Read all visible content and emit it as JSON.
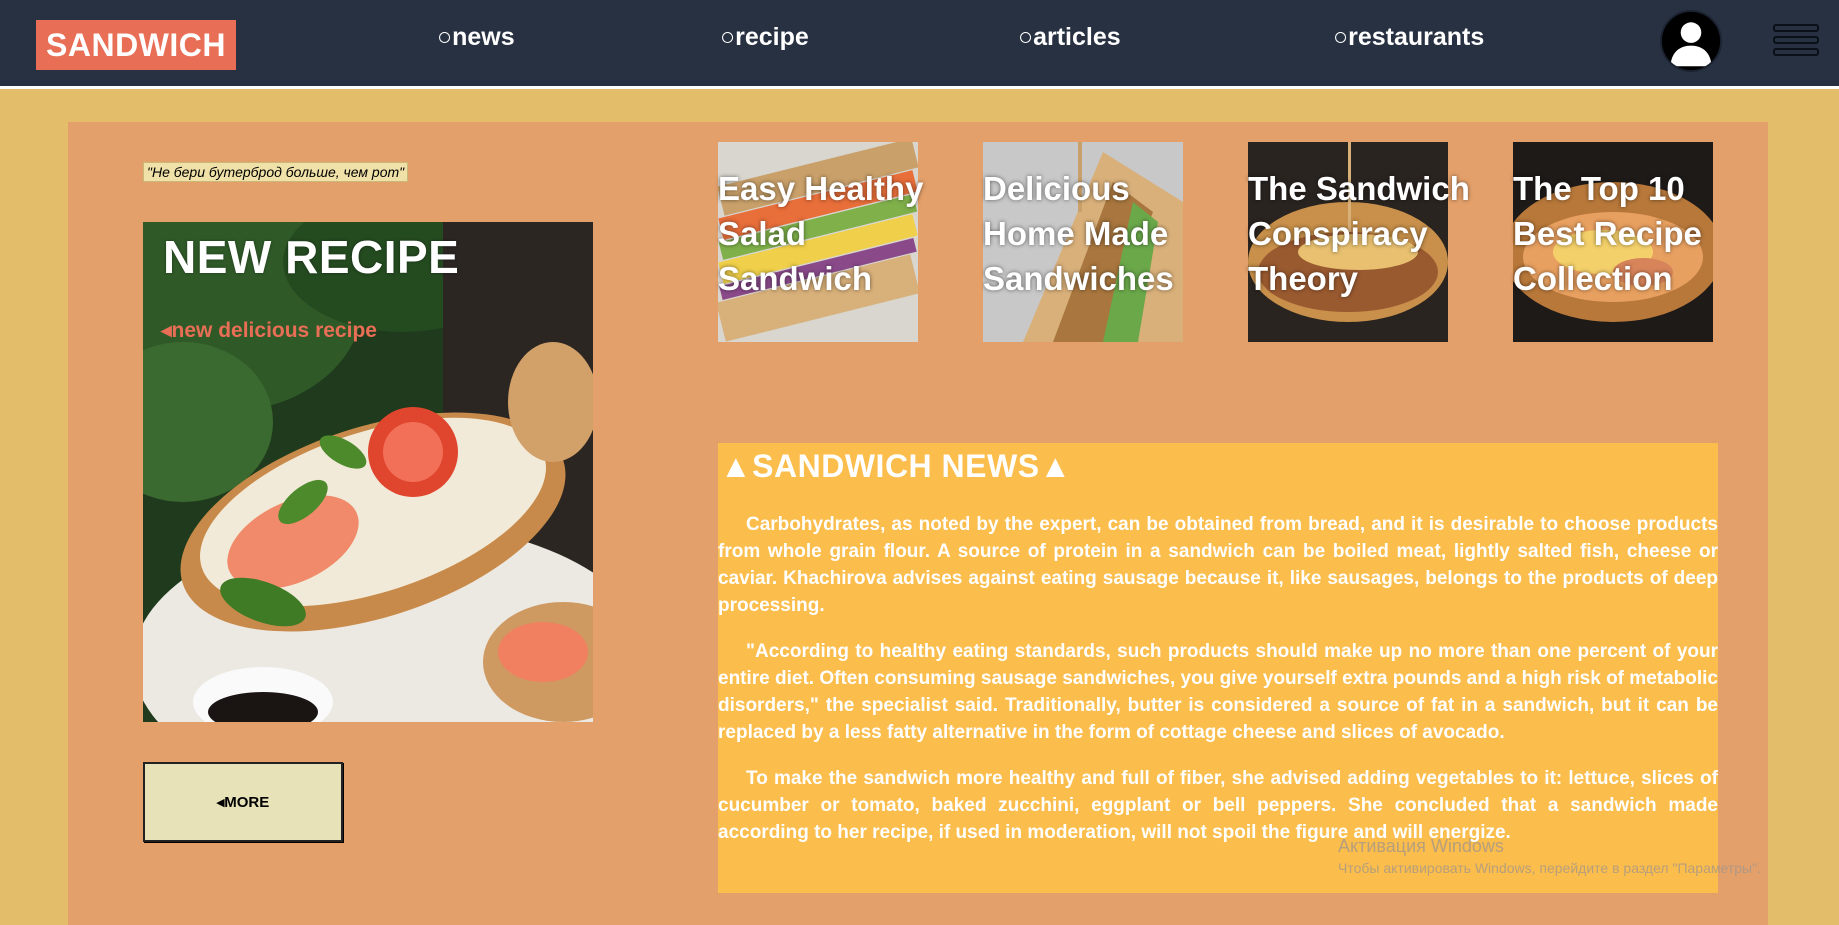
{
  "header": {
    "logo": "SANDWICH",
    "nav": [
      {
        "label": "○news"
      },
      {
        "label": "○recipe"
      },
      {
        "label": "○articles"
      },
      {
        "label": "○restaurants"
      }
    ],
    "avatar_icon": "user-avatar-icon",
    "menu_icon": "hamburger-menu-icon"
  },
  "main": {
    "quote": "\"Не бери бутерброд больше, чем рот\"",
    "hero": {
      "title": "NEW RECIPE",
      "subtitle": "◂new delicious recipe"
    },
    "more_button": "◂MORE",
    "cards": [
      {
        "label": "Easy Healthy Salad Sandwich"
      },
      {
        "label": "Delicious Home Made Sandwiches"
      },
      {
        "label": "The Sandwich Conspiracy Theory"
      },
      {
        "label": "The Top 10 Best Recipe Collection"
      }
    ],
    "news": {
      "title": "▲SANDWICH NEWS▲",
      "paragraphs": [
        "Carbohydrates, as noted by the expert, can be obtained from bread, and it is desirable to choose products from whole grain flour. A source of protein in a sandwich can be boiled meat, lightly salted fish, cheese or caviar. Khachirova advises against eating sausage because it, like sausages, belongs to the products of deep processing.",
        "\"According to healthy eating standards, such products should make up no more than one percent of your entire diet. Often consuming sausage sandwiches, you give yourself extra pounds and a high risk of metabolic disorders,\" the specialist said. Traditionally, butter is considered a source of fat in a sandwich, but it can be replaced by a less fatty alternative in the form of cottage cheese and slices of avocado.",
        "To make the sandwich more healthy and full of fiber, she advised adding vegetables to it: lettuce, slices of cucumber or tomato, baked zucchini, eggplant or bell peppers. She concluded that a sandwich made according to her recipe, if used in moderation, will not spoil the figure and will energize."
      ]
    }
  },
  "watermark": {
    "line1": "Активация Windows",
    "line2": "Чтобы активировать Windows, перейдите в раздел \"Параметры\"."
  },
  "colors": {
    "header_bg": "#283142",
    "page_bg": "#e3bd6a",
    "panel_bg": "#e4a06a",
    "accent": "#e86e55",
    "news_bg": "#fbbd4c"
  }
}
